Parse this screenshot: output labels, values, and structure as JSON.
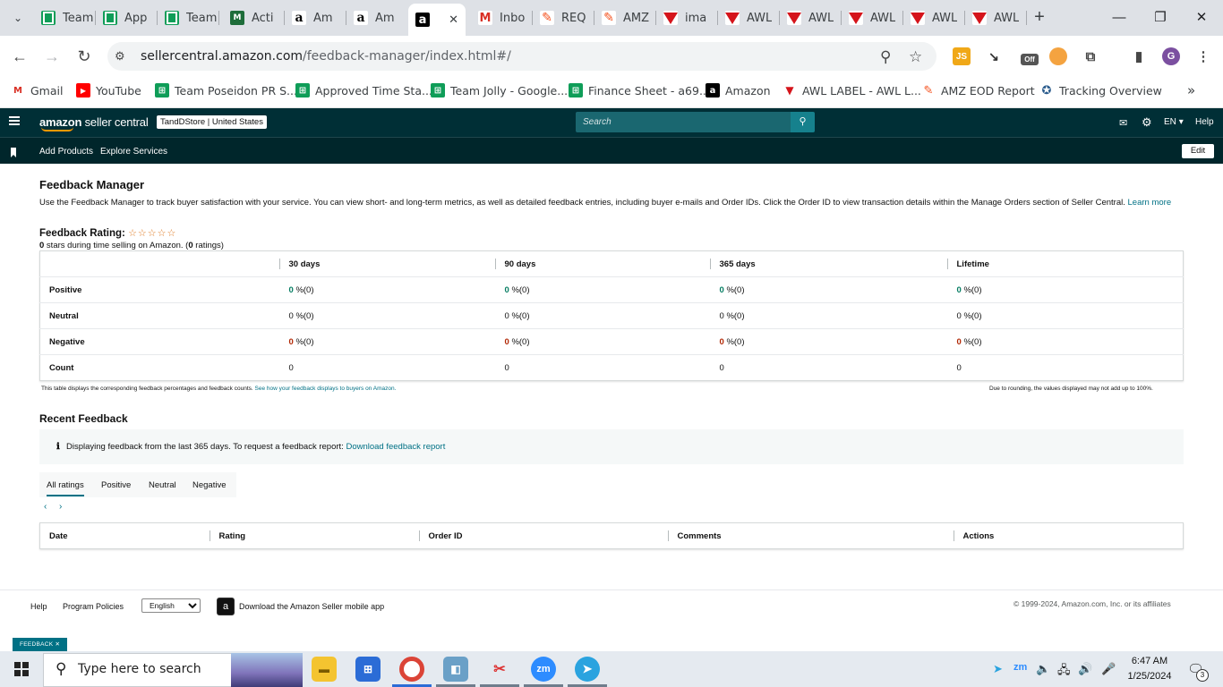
{
  "browser": {
    "tabs": [
      {
        "label": "Team",
        "icon": "sheets-icon"
      },
      {
        "label": "App",
        "icon": "sheets-icon"
      },
      {
        "label": "Team",
        "icon": "sheets-icon"
      },
      {
        "label": "Acti",
        "icon": "mint-icon"
      },
      {
        "label": "Am",
        "icon": "amazon-icon"
      },
      {
        "label": "Am",
        "icon": "amazon-icon"
      },
      {
        "label": "",
        "icon": "amazon-dark-icon",
        "active": true
      },
      {
        "label": "Inbo",
        "icon": "gmail-icon"
      },
      {
        "label": "REQ",
        "icon": "clickup-icon"
      },
      {
        "label": "AMZ",
        "icon": "clickup-icon"
      },
      {
        "label": "ima",
        "icon": "awl-icon"
      },
      {
        "label": "AWL",
        "icon": "awl-icon"
      },
      {
        "label": "AWL",
        "icon": "awl-icon"
      },
      {
        "label": "AWL",
        "icon": "awl-icon"
      },
      {
        "label": "AWL",
        "icon": "awl-icon"
      },
      {
        "label": "AWL",
        "icon": "awl-icon"
      }
    ],
    "url_host": "sellercentral.amazon.com",
    "url_path": "/feedback-manager/index.html#/",
    "ext_js": "JS",
    "ext_off": "Off",
    "profile_initial": "G",
    "bookmarks": [
      {
        "label": "Gmail",
        "icon": "gmail-icon"
      },
      {
        "label": "YouTube",
        "icon": "youtube-icon"
      },
      {
        "label": "Team Poseidon PR S...",
        "icon": "sheets-icon"
      },
      {
        "label": "Approved Time Sta...",
        "icon": "sheets-icon"
      },
      {
        "label": "Team Jolly - Google...",
        "icon": "sheets-icon"
      },
      {
        "label": "Finance Sheet - a69...",
        "icon": "sheets-icon"
      },
      {
        "label": "Amazon",
        "icon": "amazon-dark-icon"
      },
      {
        "label": "AWL LABEL - AWL L...",
        "icon": "awl-icon"
      },
      {
        "label": "AMZ EOD Report",
        "icon": "clickup-icon"
      },
      {
        "label": "Tracking Overview",
        "icon": "tracking-icon"
      }
    ]
  },
  "seller_central": {
    "logo_bold": "amazon",
    "logo_thin": "seller central",
    "store": "TandDStore | United States",
    "search_placeholder": "Search",
    "lang": "EN",
    "help": "Help",
    "sub_links": [
      "Add Products",
      "Explore Services"
    ],
    "edit": "Edit"
  },
  "page": {
    "title": "Feedback Manager",
    "description": "Use the Feedback Manager to track buyer satisfaction with your service. You can view short- and long-term metrics, as well as detailed feedback entries, including buyer e-mails and Order IDs. Click the Order ID to view transaction details within the Manage Orders section of Seller Central.",
    "learn_more": "Learn more",
    "rating_label": "Feedback Rating:",
    "stars": "☆☆☆☆☆",
    "rating_value": "0",
    "rating_mid": " stars during time selling on Amazon. (",
    "rating_count": "0",
    "rating_end": " ratings)",
    "metrics": {
      "columns": [
        "30 days",
        "90 days",
        "365 days",
        "Lifetime"
      ],
      "rows": [
        {
          "label": "Positive",
          "values": [
            "0",
            "0",
            "0",
            "0"
          ],
          "suffix": "%(0)",
          "tone": "positive"
        },
        {
          "label": "Neutral",
          "values": [
            "0",
            "0",
            "0",
            "0"
          ],
          "suffix": "%(0)",
          "tone": "neutral"
        },
        {
          "label": "Negative",
          "values": [
            "0",
            "0",
            "0",
            "0"
          ],
          "suffix": "%(0)",
          "tone": "negative"
        },
        {
          "label": "Count",
          "values": [
            "0",
            "0",
            "0",
            "0"
          ],
          "suffix": "",
          "tone": "count"
        }
      ]
    },
    "table_note": "This table displays the corresponding feedback percentages and feedback counts.",
    "table_note_link": "See how your feedback displays to buyers on Amazon.",
    "rounding_note": "Due to rounding, the values displayed may not add up to 100%.",
    "recent_title": "Recent Feedback",
    "info_text": "Displaying feedback from the last 365 days. To request a feedback report:",
    "info_link": "Download feedback report",
    "filter_tabs": [
      "All ratings",
      "Positive",
      "Neutral",
      "Negative"
    ],
    "pager_prev": "‹",
    "pager_next": "›",
    "feedback_columns": [
      "Date",
      "Rating",
      "Order ID",
      "Comments",
      "Actions"
    ]
  },
  "footer": {
    "help": "Help",
    "policies": "Program Policies",
    "language": "English",
    "app_text": "Download the Amazon Seller mobile app",
    "copyright": "© 1999-2024, Amazon.com, Inc. or its affiliates",
    "feedback_badge": "FEEDBACK ✕"
  },
  "taskbar": {
    "search_placeholder": "Type here to search",
    "time": "6:47 AM",
    "date": "1/25/2024",
    "notifications": "3"
  }
}
